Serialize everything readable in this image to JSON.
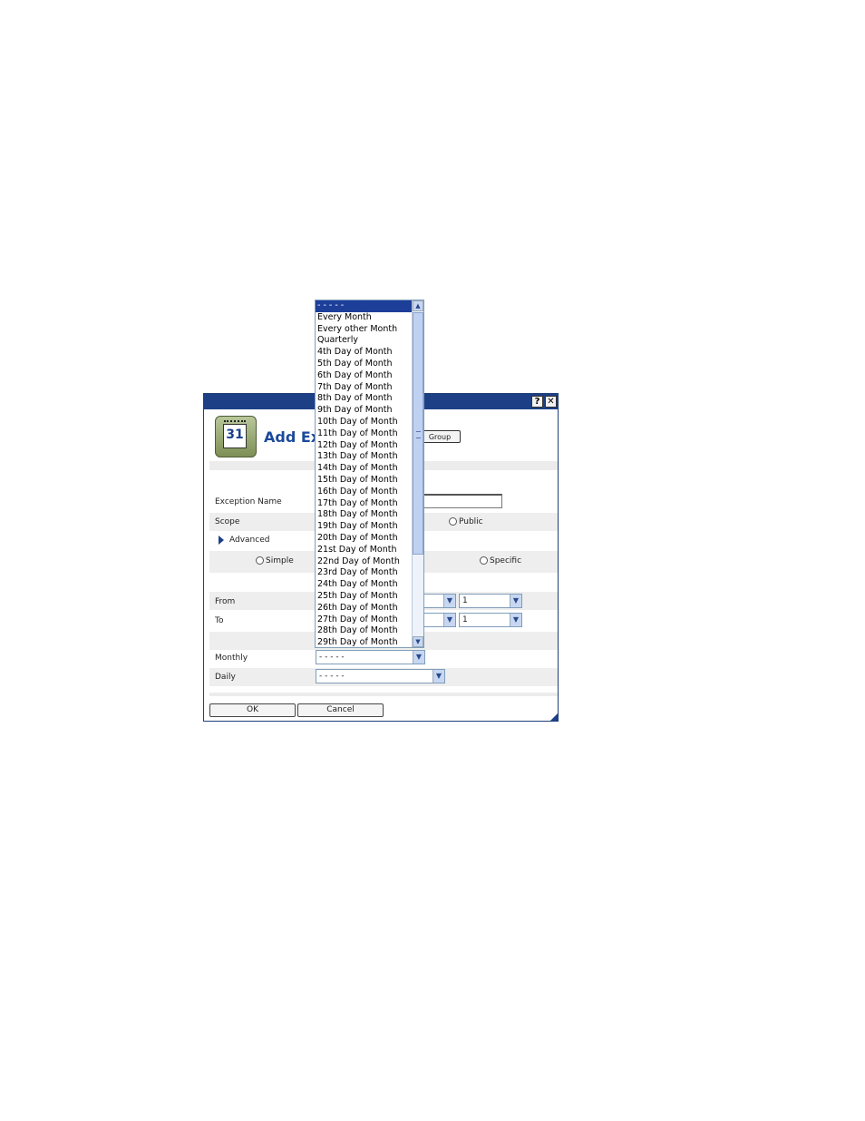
{
  "dialog": {
    "title": "Add Exc",
    "help_button": "?",
    "close_button": "✕",
    "group_button": "Group",
    "calendar_icon_number": "31"
  },
  "form": {
    "exception_name_label": "Exception Name",
    "exception_name_value": "",
    "scope_label": "Scope",
    "scope_public_label": "Public",
    "advanced_label": "Advanced",
    "simple_label": "Simple",
    "specific_label": "Specific",
    "from_label": "From",
    "to_label": "To",
    "from_day_value": "1",
    "to_day_value": "1",
    "monthly_label": "Monthly",
    "monthly_value": "- - - - -",
    "daily_label": "Daily",
    "daily_value": "- - - - -"
  },
  "buttons": {
    "ok": "OK",
    "cancel": "Cancel"
  },
  "dropdown": {
    "selected_index": 0,
    "options": [
      "- - - - -",
      "Every Month",
      "Every other Month",
      "Quarterly",
      "4th Day of Month",
      "5th Day of Month",
      "6th Day of Month",
      "7th Day of Month",
      "8th Day of Month",
      "9th Day of Month",
      "10th Day of Month",
      "11th Day of Month",
      "12th Day of Month",
      "13th Day of Month",
      "14th Day of Month",
      "15th Day of Month",
      "16th Day of Month",
      "17th Day of Month",
      "18th Day of Month",
      "19th Day of Month",
      "20th Day of Month",
      "21st Day of Month",
      "22nd Day of Month",
      "23rd Day of Month",
      "24th Day of Month",
      "25th Day of Month",
      "26th Day of Month",
      "27th Day of Month",
      "28th Day of Month",
      "29th Day of Month"
    ]
  },
  "icons": {
    "help": "help-icon",
    "close": "close-icon",
    "calendar": "calendar-icon",
    "expand": "triangle-right-icon",
    "dropdown_arrow": "chevron-down-icon",
    "scroll_up": "chevron-up-icon",
    "scroll_down": "chevron-down-icon"
  },
  "colors": {
    "titlebar": "#1c3f86",
    "title_text": "#1c4a9b",
    "selection": "#1d3f9a"
  }
}
